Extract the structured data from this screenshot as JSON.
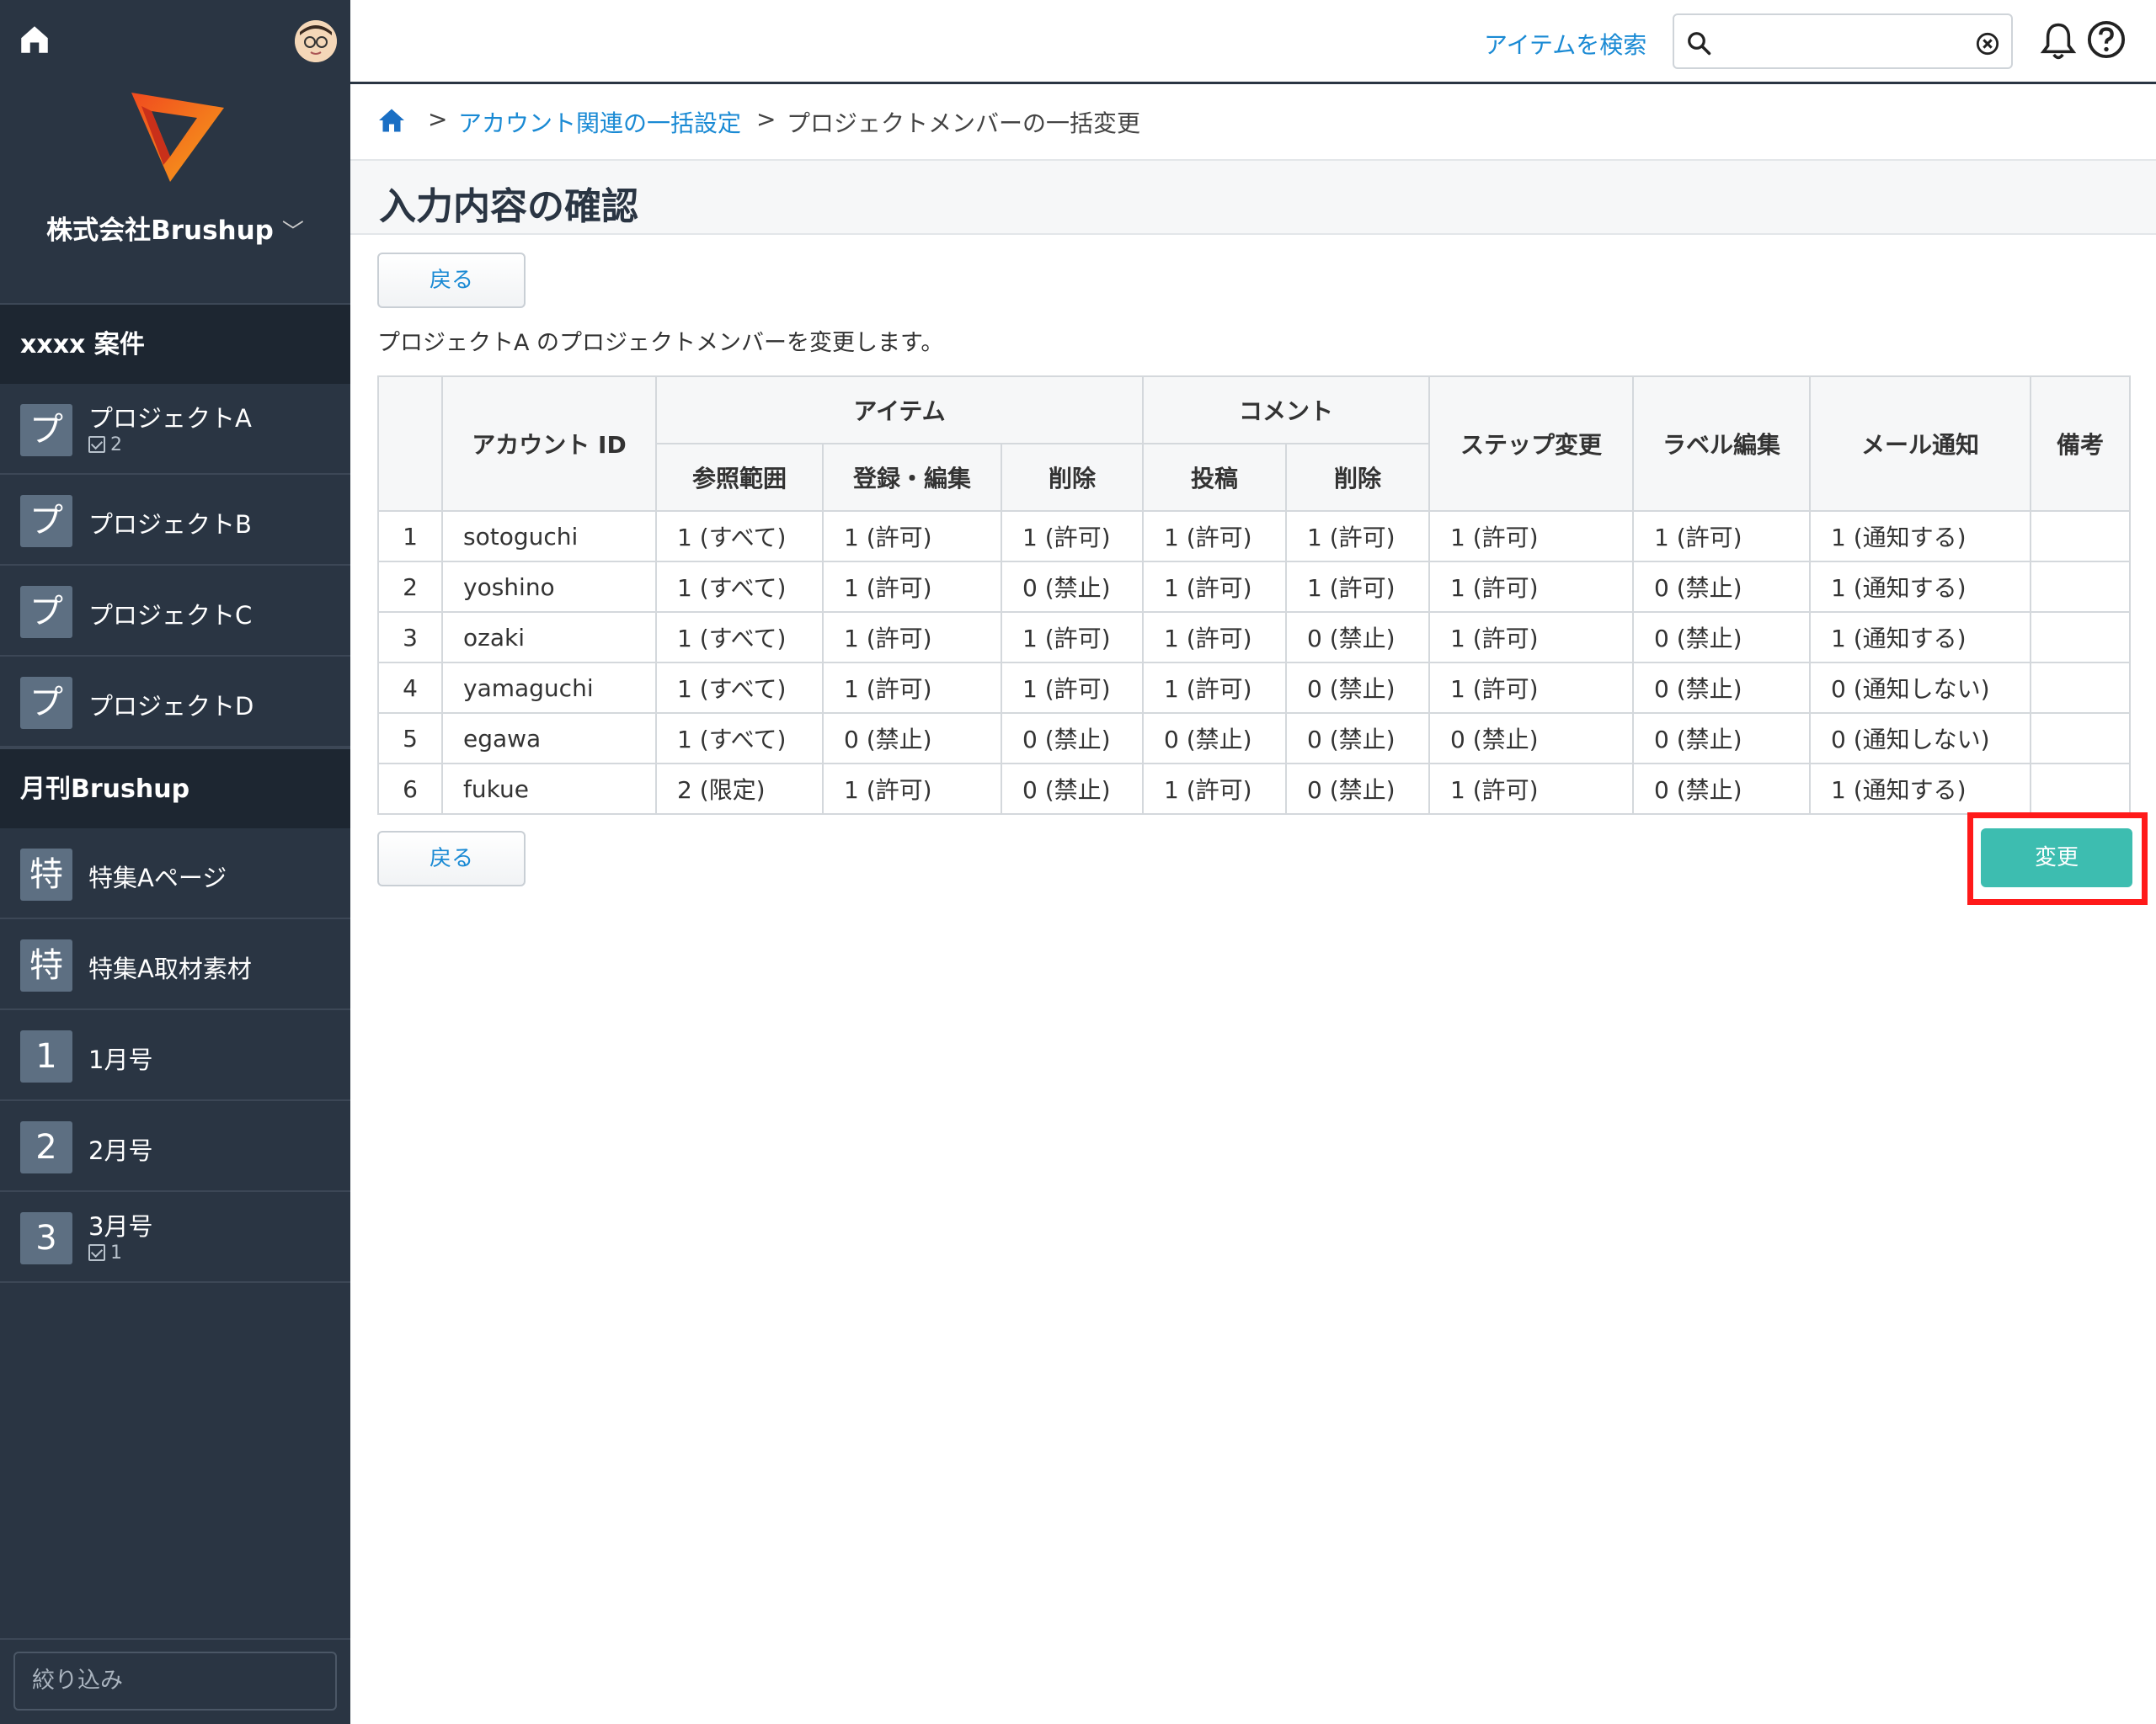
{
  "sidebar": {
    "company_name": "株式会社Brushup",
    "groups": [
      {
        "title": "xxxx 案件",
        "items": [
          {
            "badge": "プ",
            "label": "プロジェクトA",
            "task_count": "2"
          },
          {
            "badge": "プ",
            "label": "プロジェクトB"
          },
          {
            "badge": "プ",
            "label": "プロジェクトC"
          },
          {
            "badge": "プ",
            "label": "プロジェクトD"
          }
        ]
      },
      {
        "title": "月刊Brushup",
        "items": [
          {
            "badge": "特",
            "label": "特集Aページ"
          },
          {
            "badge": "特",
            "label": "特集A取材素材"
          },
          {
            "badge": "1",
            "label": "1月号"
          },
          {
            "badge": "2",
            "label": "2月号"
          },
          {
            "badge": "3",
            "label": "3月号",
            "task_count": "1"
          }
        ]
      }
    ],
    "filter_placeholder": "絞り込み"
  },
  "header": {
    "search_link": "アイテムを検索",
    "search_value": ""
  },
  "breadcrumb": {
    "separator": ">",
    "items": [
      "アカウント関連の一括設定",
      "プロジェクトメンバーの一括変更"
    ]
  },
  "page": {
    "title": "入力内容の確認",
    "back_label": "戻る",
    "submit_label": "変更",
    "description": "プロジェクトA のプロジェクトメンバーを変更します。"
  },
  "table": {
    "headers": {
      "account_id": "アカウント ID",
      "item_group": "アイテム",
      "comment_group": "コメント",
      "step_change": "ステップ変更",
      "label_edit": "ラベル編集",
      "mail_notify": "メール通知",
      "notes": "備考",
      "item_scope": "参照範囲",
      "item_edit": "登録・編集",
      "item_delete": "削除",
      "comment_post": "投稿",
      "comment_delete": "削除"
    },
    "rows": [
      {
        "no": "1",
        "account": "sotoguchi",
        "scope": "1 (すべて)",
        "edit": "1 (許可)",
        "item_del": "1 (許可)",
        "post": "1 (許可)",
        "comment_del": "1 (許可)",
        "step": "1 (許可)",
        "label": "1 (許可)",
        "mail": "1 (通知する)",
        "note": ""
      },
      {
        "no": "2",
        "account": "yoshino",
        "scope": "1 (すべて)",
        "edit": "1 (許可)",
        "item_del": "0 (禁止)",
        "post": "1 (許可)",
        "comment_del": "1 (許可)",
        "step": "1 (許可)",
        "label": "0 (禁止)",
        "mail": "1 (通知する)",
        "note": ""
      },
      {
        "no": "3",
        "account": "ozaki",
        "scope": "1 (すべて)",
        "edit": "1 (許可)",
        "item_del": "1 (許可)",
        "post": "1 (許可)",
        "comment_del": "0 (禁止)",
        "step": "1 (許可)",
        "label": "0 (禁止)",
        "mail": "1 (通知する)",
        "note": ""
      },
      {
        "no": "4",
        "account": "yamaguchi",
        "scope": "1 (すべて)",
        "edit": "1 (許可)",
        "item_del": "1 (許可)",
        "post": "1 (許可)",
        "comment_del": "0 (禁止)",
        "step": "1 (許可)",
        "label": "0 (禁止)",
        "mail": "0 (通知しない)",
        "note": ""
      },
      {
        "no": "5",
        "account": "egawa",
        "scope": "1 (すべて)",
        "edit": "0 (禁止)",
        "item_del": "0 (禁止)",
        "post": "0 (禁止)",
        "comment_del": "0 (禁止)",
        "step": "0 (禁止)",
        "label": "0 (禁止)",
        "mail": "0 (通知しない)",
        "note": ""
      },
      {
        "no": "6",
        "account": "fukue",
        "scope": "2 (限定)",
        "edit": "1 (許可)",
        "item_del": "0 (禁止)",
        "post": "1 (許可)",
        "comment_del": "0 (禁止)",
        "step": "1 (許可)",
        "label": "0 (禁止)",
        "mail": "1 (通知する)",
        "note": ""
      }
    ]
  },
  "colors": {
    "sidebar_bg": "#2a3543",
    "link": "#1a8ad4",
    "submit": "#3dbdb0",
    "highlight": "#ff1a1a"
  }
}
